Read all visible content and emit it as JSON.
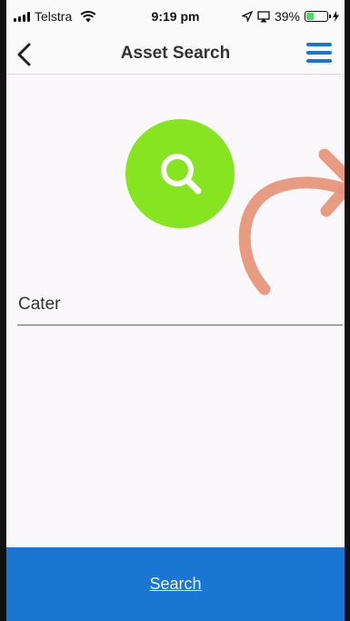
{
  "status_bar": {
    "carrier": "Telstra",
    "time": "9:19 pm",
    "battery_percent": "39%",
    "battery_level": 0.39
  },
  "nav": {
    "title": "Asset Search",
    "back_icon": "chevron-left-icon",
    "menu_icon": "hamburger-menu-icon"
  },
  "search_form": {
    "icon": "search-icon",
    "query_value": "Cater"
  },
  "footer": {
    "search_label": "Search"
  },
  "colors": {
    "accent": "#1976d2",
    "search_circle": "#86e420",
    "overlay_arrow": "#e8967a"
  }
}
